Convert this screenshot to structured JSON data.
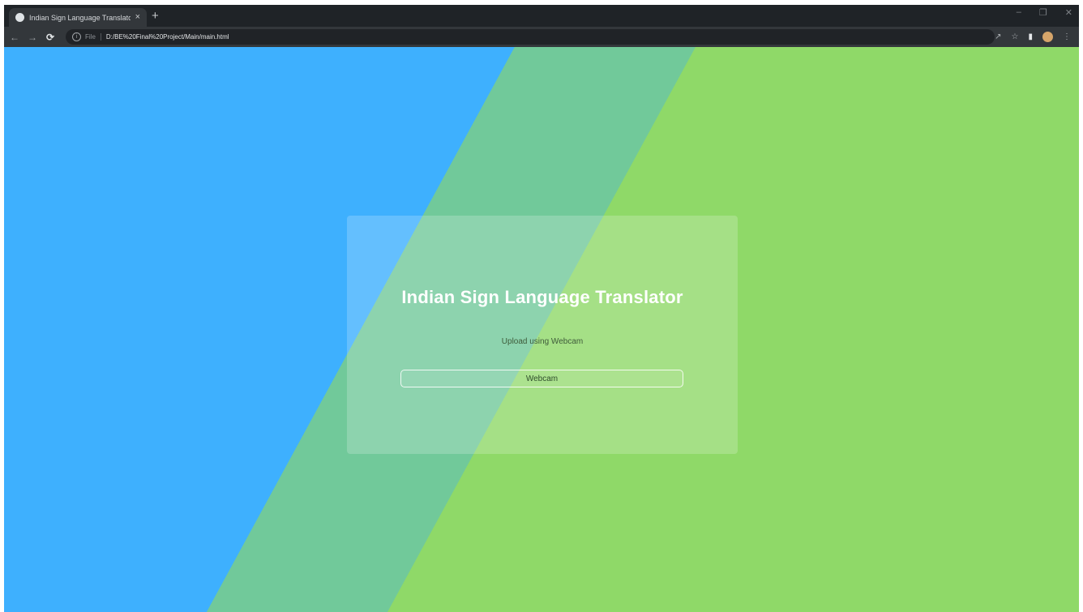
{
  "browser": {
    "tab_title": "Indian Sign Language Translator",
    "tab_close": "×",
    "new_tab": "+",
    "url_scheme": "File",
    "url": "D:/BE%20Final%20Project/Main/main.html",
    "window_controls": [
      "–",
      "❐",
      "✕"
    ],
    "icons": [
      "back-icon",
      "forward-icon",
      "reload-icon",
      "info-icon",
      "share-icon",
      "star-icon",
      "extension-icon",
      "profile-avatar",
      "menu-icon"
    ]
  },
  "colors": {
    "left_panel": "#3eb0fe",
    "middle_band": "#71c99a",
    "right_panel": "#8fd968"
  },
  "card": {
    "title": "Indian Sign Language Translator",
    "subtitle": "Upload using Webcam",
    "button_label": "Webcam"
  }
}
